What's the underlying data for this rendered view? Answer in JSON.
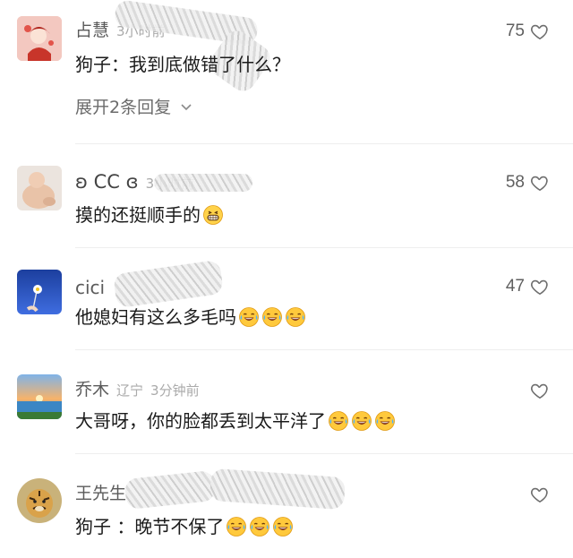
{
  "comments": [
    {
      "username": "占慧",
      "time": "3小时前",
      "text": "狗子：我到底做错了什么？",
      "likes": "75",
      "avatar": "girl-illustration-avatar",
      "expand_label": "展开2条回复",
      "emojis": []
    },
    {
      "username": "ʚ CC ɞ",
      "time": "3小时前",
      "text": "摸的还挺顺手的",
      "likes": "58",
      "avatar": "baby-photo-avatar",
      "emojis": [
        "grin-emoji"
      ]
    },
    {
      "username": "cici",
      "time": "",
      "text": "他媳妇有这么多毛吗",
      "likes": "47",
      "avatar": "flower-blue-sky-avatar",
      "emojis": [
        "laugh-cry-emoji",
        "laugh-cry-emoji",
        "laugh-cry-emoji"
      ]
    },
    {
      "username": "乔木",
      "location": "辽宁",
      "time": "3分钟前",
      "text": "大哥呀，你的脸都丢到太平洋了",
      "likes": "",
      "avatar": "sunset-sea-avatar",
      "emojis": [
        "laugh-cry-emoji",
        "laugh-cry-emoji",
        "laugh-cry-emoji"
      ]
    },
    {
      "username": "王先生",
      "time": "",
      "text": "狗子 ：晚节不保了",
      "likes": "",
      "avatar": "tiger-avatar",
      "emojis": [
        "laugh-cry-emoji",
        "laugh-cry-emoji",
        "laugh-cry-emoji"
      ]
    }
  ],
  "colors": {
    "text": "#1b1b1b",
    "meta": "#5b5b5b",
    "time": "#aaaaaa",
    "divider": "#eeeeee"
  }
}
